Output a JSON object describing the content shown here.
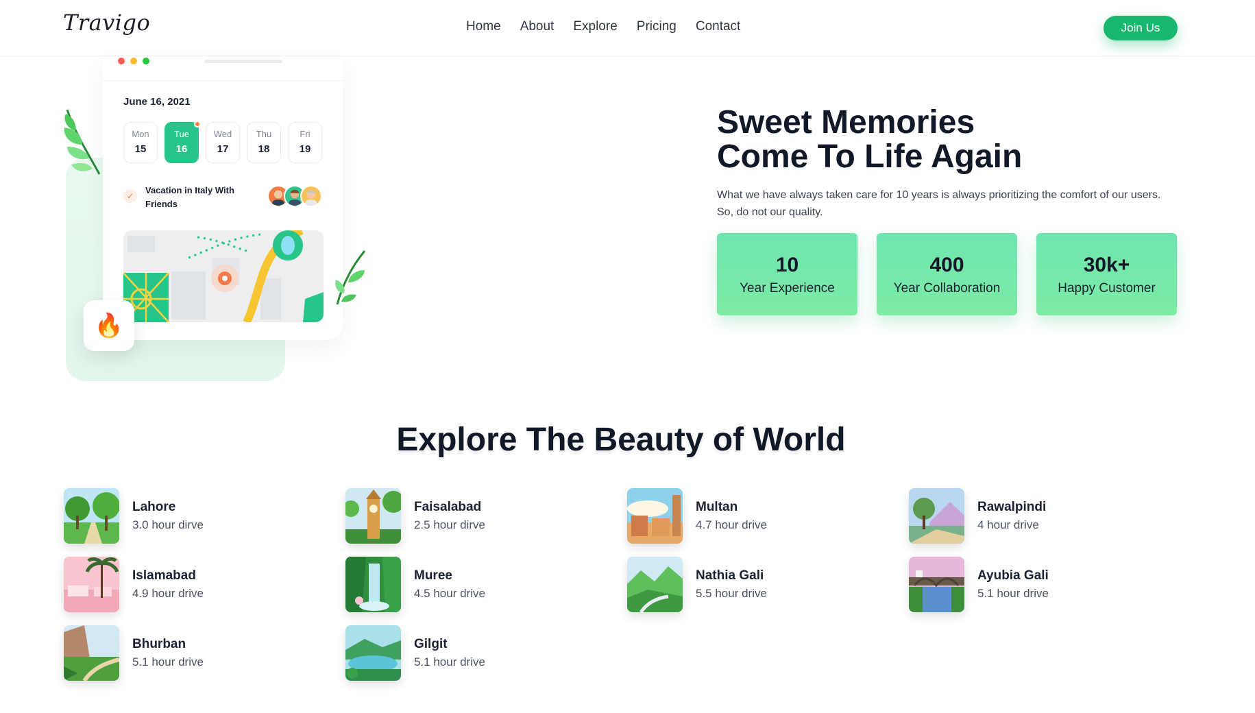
{
  "header": {
    "logo": "Travigo",
    "nav": [
      "Home",
      "About",
      "Explore",
      "Pricing",
      "Contact"
    ],
    "join_label": "Join Us"
  },
  "illustration": {
    "date": "June 16, 2021",
    "days": [
      {
        "name": "Mon",
        "num": "15"
      },
      {
        "name": "Tue",
        "num": "16"
      },
      {
        "name": "Wed",
        "num": "17"
      },
      {
        "name": "Thu",
        "num": "18"
      },
      {
        "name": "Fri",
        "num": "19"
      }
    ],
    "active_day": "Tue",
    "todo": "Vacation in Italy With Friends"
  },
  "hero": {
    "title_line1": "Sweet Memories",
    "title_line2": "Come To Life Again",
    "description": "What we have always taken care for 10 years is always prioritizing the comfort of our users. So, do not our quality.",
    "stats": [
      {
        "value": "10",
        "label": "Year Experience"
      },
      {
        "value": "400",
        "label": "Year Collaboration"
      },
      {
        "value": "30k+",
        "label": "Happy Customer"
      }
    ]
  },
  "explore": {
    "title": "Explore The Beauty of World",
    "destinations": [
      {
        "name": "Lahore",
        "time": "3.0 hour dirve"
      },
      {
        "name": "Faisalabad",
        "time": "2.5 hour dirve"
      },
      {
        "name": "Multan",
        "time": "4.7 hour drive"
      },
      {
        "name": "Rawalpindi",
        "time": "4 hour drive"
      },
      {
        "name": "Islamabad",
        "time": "4.9 hour drive"
      },
      {
        "name": "Muree",
        "time": "4.5 hour drive"
      },
      {
        "name": "Nathia Gali",
        "time": "5.5 hour drive"
      },
      {
        "name": "Ayubia Gali",
        "time": "5.1 hour drive"
      },
      {
        "name": "Bhurban",
        "time": "5.1 hour drive"
      },
      {
        "name": "Gilgit",
        "time": "5.1 hour drive"
      }
    ]
  },
  "colors": {
    "accent": "#17b86d",
    "stat_bg": "#74e8ab",
    "heading": "#111827"
  }
}
